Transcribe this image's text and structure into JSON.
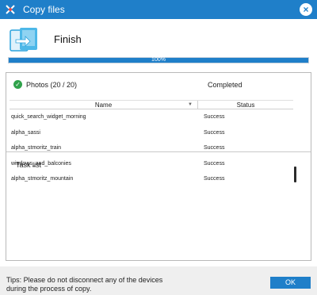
{
  "window": {
    "title": "Copy files",
    "close_label": "×"
  },
  "header": {
    "status_title": "Finish"
  },
  "progress": {
    "value": 1.0,
    "label": "100%"
  },
  "summary": {
    "item_label": "Photos (20 / 20)",
    "item_status": "Completed"
  },
  "task_list": {
    "label": "Task list",
    "columns": [
      "Name",
      "Status"
    ],
    "rows": [
      {
        "name": "quick_search_widget_morning",
        "status": "Success"
      },
      {
        "name": "alpha_sassi",
        "status": "Success"
      },
      {
        "name": "alpha_stmoritz_train",
        "status": "Success"
      },
      {
        "name": "windows_and_balconies",
        "status": "Success"
      },
      {
        "name": "alpha_stmoritz_mountain",
        "status": "Success"
      }
    ]
  },
  "footer": {
    "tips_line1": "Tips: Please do not disconnect any of the devices",
    "tips_line2": "during the process of copy.",
    "ok_label": "OK"
  },
  "colors": {
    "accent": "#1f7fc9",
    "success": "#30a24b"
  },
  "icons": [
    "app-icon",
    "close-icon",
    "device-transfer-icon",
    "check-circle-icon",
    "sort-arrow-icon"
  ]
}
